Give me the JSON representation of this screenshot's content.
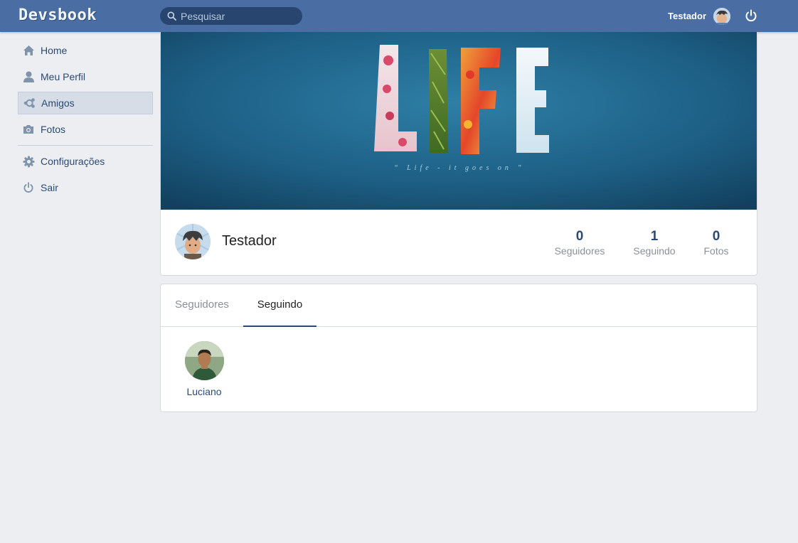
{
  "app": {
    "logo": "Devsbook"
  },
  "search": {
    "placeholder": "Pesquisar"
  },
  "user_menu": {
    "name": "Testador"
  },
  "sidebar": {
    "items": [
      {
        "label": "Home",
        "icon": "home-icon"
      },
      {
        "label": "Meu Perfil",
        "icon": "user-icon"
      },
      {
        "label": "Amigos",
        "icon": "friends-icon",
        "active": true
      },
      {
        "label": "Fotos",
        "icon": "camera-icon"
      },
      {
        "label": "Configurações",
        "icon": "gear-icon"
      },
      {
        "label": "Sair",
        "icon": "power-icon"
      }
    ]
  },
  "cover": {
    "title": "LIFE",
    "tagline": "“ Life - it goes on ”"
  },
  "profile": {
    "name": "Testador",
    "stats": [
      {
        "value": "0",
        "label": "Seguidores"
      },
      {
        "value": "1",
        "label": "Seguindo"
      },
      {
        "value": "0",
        "label": "Fotos"
      }
    ]
  },
  "tabs": [
    {
      "label": "Seguidores",
      "active": false
    },
    {
      "label": "Seguindo",
      "active": true
    }
  ],
  "following": [
    {
      "name": "Luciano"
    }
  ],
  "colors": {
    "topbar": "#4a6ea3",
    "search_bg": "#27456f",
    "accent": "#2b4a73",
    "page_bg": "#eceef1"
  }
}
